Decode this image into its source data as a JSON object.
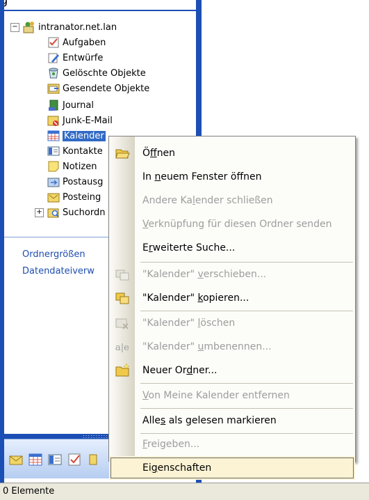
{
  "folder_pane": {
    "header_partial": "g",
    "root": {
      "label": "intranator.net.lan",
      "expander": "−"
    },
    "items": [
      {
        "label": "Aufgaben"
      },
      {
        "label": "Entwürfe"
      },
      {
        "label": "Gelöschte Objekte"
      },
      {
        "label": "Gesendete Objekte"
      },
      {
        "label": "Journal"
      },
      {
        "label": "Junk-E-Mail"
      },
      {
        "label": "Kalender"
      },
      {
        "label": "Kontakte"
      },
      {
        "label": "Notizen"
      },
      {
        "label": "Postausg"
      },
      {
        "label": "Posteing"
      },
      {
        "label": "Suchordn",
        "expander": "+"
      }
    ],
    "links": [
      {
        "label": "Ordnergrößen"
      },
      {
        "label": "Datendateiverw"
      }
    ]
  },
  "context_menu": {
    "items": [
      {
        "pre": "Ö",
        "u": "f",
        "post": "fnen",
        "disabled": false
      },
      {
        "pre": "In ",
        "u": "n",
        "post": "euem Fenster öffnen",
        "disabled": false
      },
      {
        "pre": "Andere Ka",
        "u": "l",
        "post": "ender schließen",
        "disabled": true
      },
      {
        "pre": "",
        "u": "V",
        "post": "erknüpfung für diesen Ordner senden",
        "disabled": true
      },
      {
        "pre": "E",
        "u": "r",
        "post": "weiterte Suche...",
        "disabled": false
      },
      {
        "pre": "\"Kalender\" ",
        "u": "v",
        "post": "erschieben...",
        "disabled": true
      },
      {
        "pre": "\"Kalender\" ",
        "u": "k",
        "post": "opieren...",
        "disabled": false
      },
      {
        "pre": "\"Kalender\" ",
        "u": "l",
        "post": "öschen",
        "disabled": true
      },
      {
        "pre": "\"Kalender\" ",
        "u": "u",
        "post": "mbenennen...",
        "disabled": true
      },
      {
        "pre": "Neuer Or",
        "u": "d",
        "post": "ner...",
        "disabled": false
      },
      {
        "pre": "",
        "u": "V",
        "post": "on Meine Kalender entfernen",
        "disabled": true
      },
      {
        "pre": "Alle",
        "u": "s",
        "post": " als gelesen markieren",
        "disabled": false
      },
      {
        "pre": "",
        "u": "F",
        "post": "reigeben...",
        "disabled": true
      },
      {
        "pre": "Ei",
        "u": "g",
        "post": "enschaften",
        "disabled": false
      }
    ]
  },
  "status_bar": {
    "text": "0 Elemente"
  },
  "colors": {
    "frame": "#1c4fb5",
    "selection": "#316ac5",
    "link": "#1f4db0",
    "menu_hover": "#fcf3d4"
  }
}
